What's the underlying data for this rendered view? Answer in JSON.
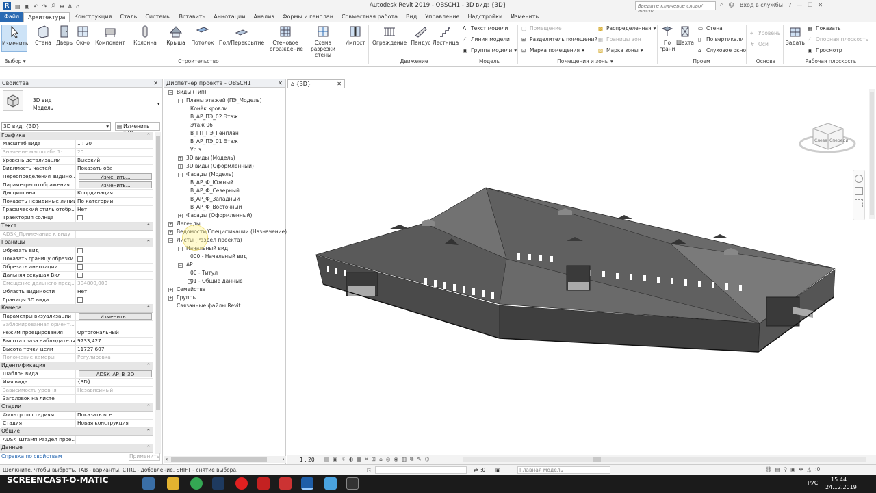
{
  "window": {
    "title": "Autodesk Revit 2019 - OBSCH1 - 3D вид: {3D}",
    "search_placeholder": "Введите ключевое слово/фразу",
    "signin": "Вход в службы"
  },
  "tabs": [
    "Файл",
    "Архитектура",
    "Конструкция",
    "Сталь",
    "Системы",
    "Вставить",
    "Аннотации",
    "Анализ",
    "Формы и генплан",
    "Совместная работа",
    "Вид",
    "Управление",
    "Надстройки",
    "Изменить"
  ],
  "ribbon": {
    "buttons": [
      "Изменить",
      "Стена",
      "Дверь",
      "Окно",
      "Компонент",
      "Колонна",
      "Крыша",
      "Потолок",
      "Пол/Перекрытие",
      "Стеновое ограждение",
      "Схема разрезки стены",
      "Импост",
      "Ограждение",
      "Пандус",
      "Лестница",
      "По грани",
      "Шахта",
      "Задать"
    ],
    "model_items": [
      "Текст модели",
      "Линия модели",
      "Группа модели"
    ],
    "room_items": [
      "Помещение",
      "Разделитель помещений",
      "Марка помещения",
      "Распределенная",
      "Границы зон",
      "Марка зоны"
    ],
    "opening_items": [
      "Стена",
      "По вертикали",
      "Слуховое окно"
    ],
    "datum_items": [
      "Уровень",
      "Оси"
    ],
    "workplane_items": [
      "Показать",
      "Опорная плоскость",
      "Просмотр"
    ],
    "groups": [
      "Выбор",
      "Строительство",
      "Движение",
      "Модель",
      "Помещения и зоны",
      "Проем",
      "Основа",
      "Рабочая плоскость"
    ]
  },
  "properties": {
    "header": "Свойства",
    "type_line1": "3D вид",
    "type_line2": "Модель",
    "selector": "3D вид: {3D}",
    "edit_type": "Изменить тип",
    "sections": [
      {
        "name": "Графика",
        "rows": [
          {
            "k": "Масштаб вида",
            "v": "1 : 20"
          },
          {
            "k": "Значение масштаба   1:",
            "v": "20",
            "dim": true
          },
          {
            "k": "Уровень детализации",
            "v": "Высокий"
          },
          {
            "k": "Видимость частей",
            "v": "Показать оба"
          },
          {
            "k": "Переопределения видимо...",
            "v": "Изменить...",
            "btn": true
          },
          {
            "k": "Параметры отображения ...",
            "v": "Изменить...",
            "btn": true
          },
          {
            "k": "Дисциплина",
            "v": "Координация"
          },
          {
            "k": "Показать невидимые линии",
            "v": "По категории"
          },
          {
            "k": "Графический стиль отобр...",
            "v": "Нет"
          },
          {
            "k": "Траектория солнца",
            "v": "",
            "cb": true
          }
        ]
      },
      {
        "name": "Текст",
        "rows": [
          {
            "k": "ADSK_Примечание к виду",
            "v": "",
            "dim": true
          }
        ]
      },
      {
        "name": "Границы",
        "rows": [
          {
            "k": "Обрезать вид",
            "v": "",
            "cb": true
          },
          {
            "k": "Показать границу обрезки",
            "v": "",
            "cb": true
          },
          {
            "k": "Обрезать аннотации",
            "v": "",
            "cb": true
          },
          {
            "k": "Дальняя секущая Вкл",
            "v": "",
            "cb": true
          },
          {
            "k": "Смещение дальнего пред...",
            "v": "304800,000",
            "dim": true
          },
          {
            "k": "Область видимости",
            "v": "Нет"
          },
          {
            "k": "Границы 3D вида",
            "v": "",
            "cb": true
          }
        ]
      },
      {
        "name": "Камера",
        "rows": [
          {
            "k": "Параметры визуализации",
            "v": "Изменить...",
            "btn": true
          },
          {
            "k": "Заблокированная ориент...",
            "v": "",
            "dim": true
          },
          {
            "k": "Режим проецирования",
            "v": "Ортогональный"
          },
          {
            "k": "Высота глаза наблюдателя",
            "v": "9733,427"
          },
          {
            "k": "Высота точки цели",
            "v": "11727,607"
          },
          {
            "k": "Положение камеры",
            "v": "Регулировка",
            "dim": true
          }
        ]
      },
      {
        "name": "Идентификация",
        "rows": [
          {
            "k": "Шаблон вида",
            "v": "ADSK_АР_В_3D",
            "btn": true
          },
          {
            "k": "Имя вида",
            "v": "{3D}"
          },
          {
            "k": "Зависимость уровня",
            "v": "Независимый",
            "dim": true
          },
          {
            "k": "Заголовок на листе",
            "v": ""
          }
        ]
      },
      {
        "name": "Стадии",
        "rows": [
          {
            "k": "Фильтр по стадиям",
            "v": "Показать все"
          },
          {
            "k": "Стадия",
            "v": "Новая конструкция"
          }
        ]
      },
      {
        "name": "Общие",
        "rows": [
          {
            "k": "ADSK_Штамп Раздел прое...",
            "v": ""
          }
        ]
      },
      {
        "name": "Данные",
        "rows": []
      }
    ],
    "help_link": "Справка по свойствам",
    "apply": "Применить"
  },
  "browser": {
    "header": "Диспетчер проекта - OBSCH1",
    "nodes": [
      {
        "t": "Виды (Тип)",
        "lvl": 0,
        "tog": "−"
      },
      {
        "t": "Планы этажей (ПЭ_Модель)",
        "lvl": 1,
        "tog": "−"
      },
      {
        "t": "Конёк кровли",
        "lvl": 2
      },
      {
        "t": "В_АР_ПЭ_02 Этаж",
        "lvl": 2
      },
      {
        "t": "Этаж 06",
        "lvl": 2
      },
      {
        "t": "В_ГП_ПЭ_Генплан",
        "lvl": 2
      },
      {
        "t": "В_АР_ПЭ_01 Этаж",
        "lvl": 2
      },
      {
        "t": "Ур.з",
        "lvl": 2
      },
      {
        "t": "3D виды (Модель)",
        "lvl": 1,
        "tog": "+"
      },
      {
        "t": "3D виды (Оформленный)",
        "lvl": 1,
        "tog": "+"
      },
      {
        "t": "Фасады (Модель)",
        "lvl": 1,
        "tog": "−"
      },
      {
        "t": "В_АР_Ф_Южный",
        "lvl": 2
      },
      {
        "t": "В_АР_Ф_Северный",
        "lvl": 2
      },
      {
        "t": "В_АР_Ф_Западный",
        "lvl": 2
      },
      {
        "t": "В_АР_Ф_Восточный",
        "lvl": 2
      },
      {
        "t": "Фасады (Оформленный)",
        "lvl": 1,
        "tog": "+"
      },
      {
        "t": "Легенды",
        "lvl": 0,
        "tog": "+"
      },
      {
        "t": "Ведомости/Спецификации (Назначение)",
        "lvl": 0,
        "tog": "+"
      },
      {
        "t": "Листы (Раздел проекта)",
        "lvl": 0,
        "tog": "−"
      },
      {
        "t": "Начальный вид",
        "lvl": 1,
        "tog": "−"
      },
      {
        "t": "000 - Начальный вид",
        "lvl": 2
      },
      {
        "t": "АР",
        "lvl": 1,
        "tog": "−"
      },
      {
        "t": "00 - Титул",
        "lvl": 2
      },
      {
        "t": "01 - Общие данные",
        "lvl": 2,
        "tog": "+"
      },
      {
        "t": "Семейства",
        "lvl": 0,
        "tog": "+"
      },
      {
        "t": "Группы",
        "lvl": 0,
        "tog": "+"
      },
      {
        "t": "Связанные файлы Revit",
        "lvl": 0
      }
    ]
  },
  "view": {
    "tab": "{3D}",
    "viewcube_left": "Слева",
    "viewcube_front": "Спереди",
    "scale": "1 : 20"
  },
  "status": {
    "text": "Щелкните, чтобы выбрать, TAB - варианты, CTRL - добавление, SHIFT - снятие выбора.",
    "zero1": ":0",
    "model": "Главная модель",
    "filter": ":0"
  },
  "taskbar": {
    "watermark": "SCREENCAST-O-MATIC",
    "lang": "РУС",
    "time": "15:44",
    "date": "24.12.2019"
  }
}
